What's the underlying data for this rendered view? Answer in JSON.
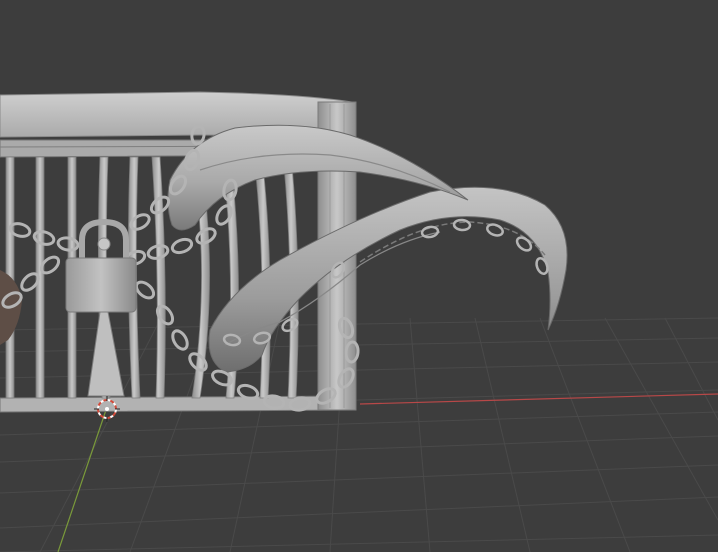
{
  "viewport": {
    "kind": "3d-viewport",
    "colors": {
      "background": "#3d3d3d",
      "grid": "#4a4a4a",
      "x_axis": "#b84848",
      "y_axis": "#7a9a3a",
      "model_fill": "#b8b8b8",
      "model_shade": "#8c8c8c",
      "model_dark": "#5e5e5e",
      "cursor_red": "#d24a3a",
      "cursor_white": "#ffffff"
    },
    "objects": [
      {
        "name": "cage",
        "icon": "none"
      },
      {
        "name": "padlock",
        "icon": "lock-icon"
      },
      {
        "name": "chains",
        "icon": "chain-icon"
      },
      {
        "name": "upper-horn",
        "icon": "none"
      },
      {
        "name": "lower-horn",
        "icon": "none"
      }
    ],
    "cursor": {
      "icon": "3d-cursor-icon"
    }
  }
}
